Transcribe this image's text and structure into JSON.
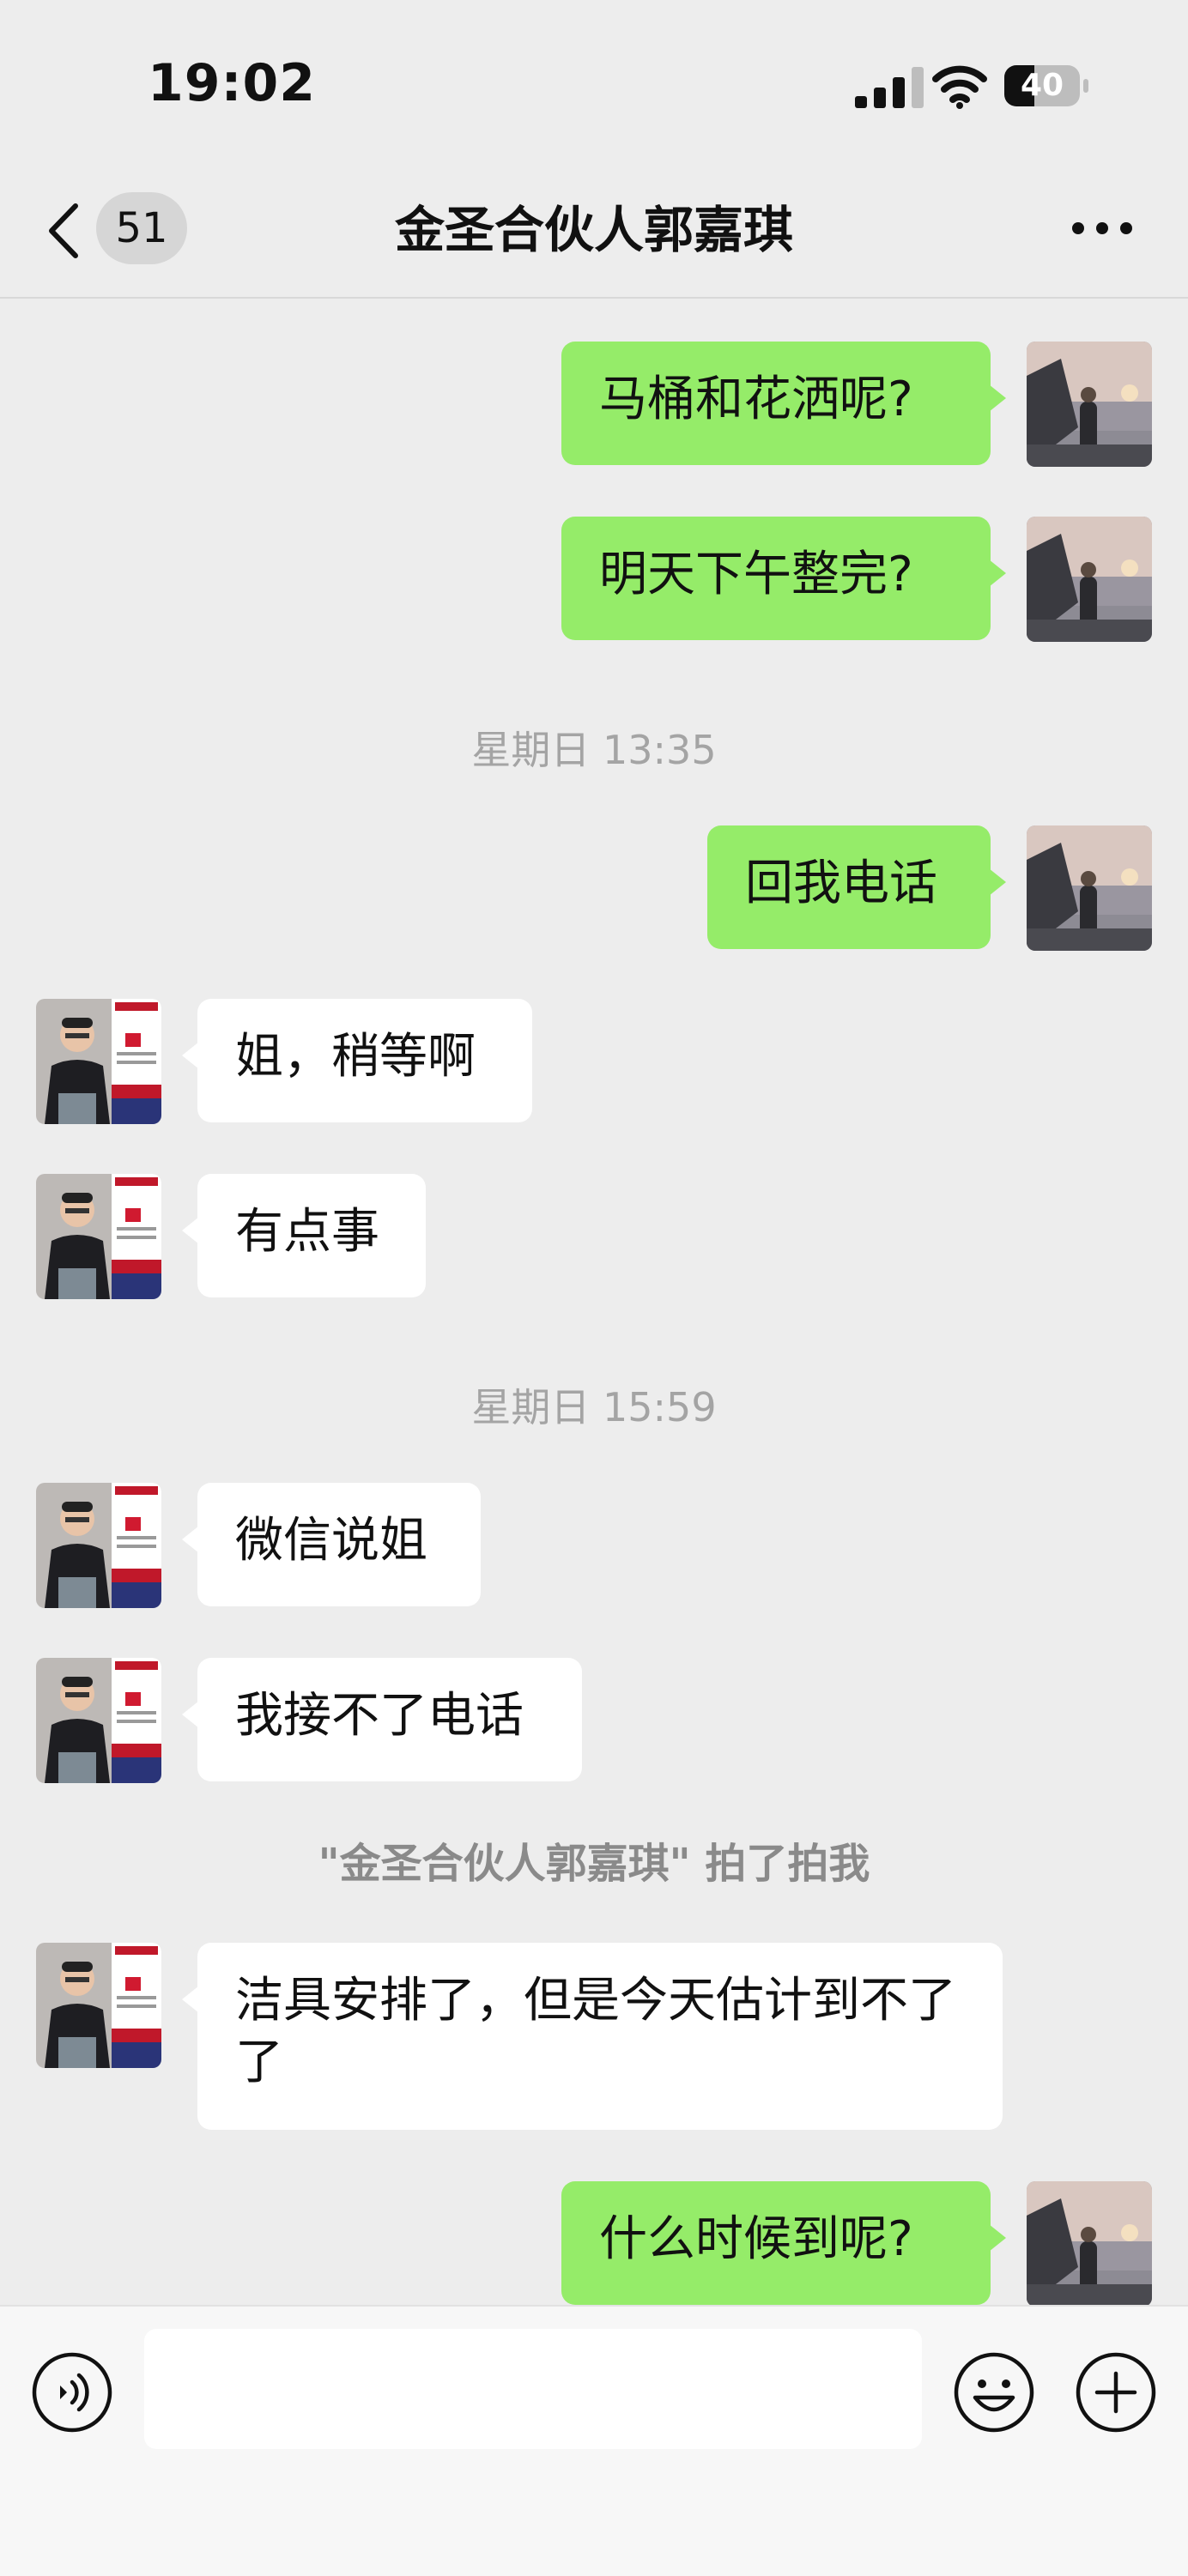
{
  "status_bar": {
    "time": "19:02",
    "battery": "40",
    "battery_level": 0.4
  },
  "header": {
    "unread_count": "51",
    "title": "金圣合伙人郭嘉琪"
  },
  "messages": [
    {
      "text": "马桶和花洒呢?"
    },
    {
      "text": "明天下午整完?"
    },
    {
      "text": "星期日 13:35"
    },
    {
      "text": "回我电话"
    },
    {
      "text": "姐，稍等啊"
    },
    {
      "text": "有点事"
    },
    {
      "text": "星期日 15:59"
    },
    {
      "text": "微信说姐"
    },
    {
      "text": "我接不了电话"
    },
    {
      "text": "\"金圣合伙人郭嘉琪\" 拍了拍我"
    },
    {
      "text": "洁具安排了，但是今天估计到不了了"
    },
    {
      "text": "什么时候到呢?"
    }
  ],
  "input_bar": {
    "value": "",
    "placeholder": ""
  },
  "icons": {
    "back": "chevron-left-icon",
    "more": "more-dots-icon",
    "voice": "voice-icon",
    "emoji": "emoji-icon",
    "plus": "plus-icon"
  },
  "colors": {
    "my_bubble": "#95ec69",
    "their_bubble": "#ffffff",
    "background": "#ededed"
  }
}
